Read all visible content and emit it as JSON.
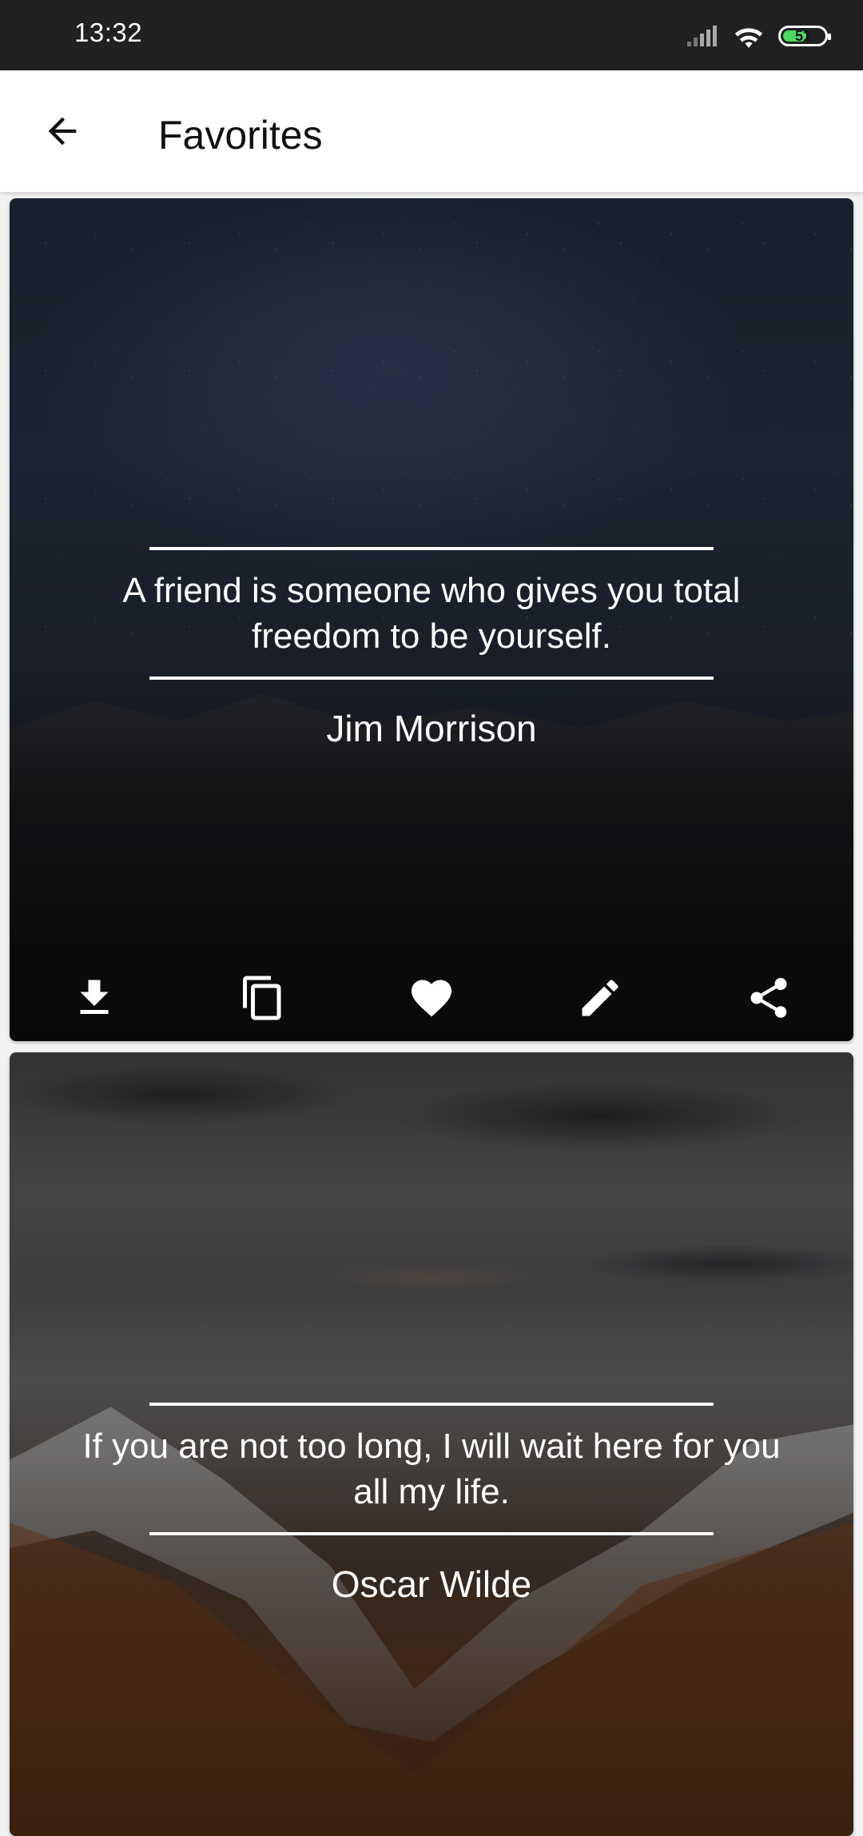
{
  "status_bar": {
    "time": "13:32",
    "battery_level": "51",
    "icons": [
      "signal-icon",
      "wifi-icon",
      "battery-icon"
    ]
  },
  "app_bar": {
    "title": "Favorites",
    "back_icon": "arrow-back-icon"
  },
  "quotes": [
    {
      "text": "A friend is someone who gives you total freedom to be yourself.",
      "author": "Jim Morrison",
      "background": "night-sky-mountains",
      "actions": [
        "download-icon",
        "copy-icon",
        "heart-icon",
        "edit-icon",
        "share-icon"
      ]
    },
    {
      "text": "If you are not too long, I will wait here for you all my life.",
      "author": "Oscar Wilde",
      "background": "cloudy-mountain-forest"
    }
  ],
  "colors": {
    "status_bar": "#212121",
    "app_bar": "#ffffff",
    "battery_fill": "#4cd964",
    "text_on_image": "#ffffff"
  }
}
